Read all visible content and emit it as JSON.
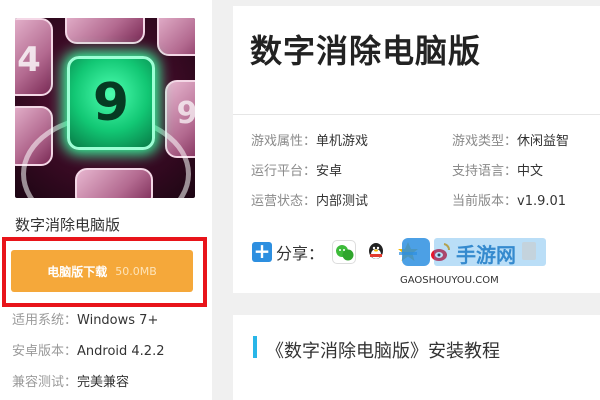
{
  "app": {
    "name": "数字消除电脑版",
    "icon_tile_number": "9",
    "icon_side_numbers": [
      "4",
      "9"
    ]
  },
  "download": {
    "label": "电脑版下载",
    "size": "50.0MB",
    "highlight_color": "#e8141a",
    "button_color": "#f5a83a"
  },
  "sidebar_info": [
    {
      "key": "适用系统：",
      "value": "Windows 7+"
    },
    {
      "key": "安卓版本：",
      "value": "Android 4.2.2"
    },
    {
      "key": "兼容测试：",
      "value": "完美兼容"
    }
  ],
  "header": {
    "title": "数字消除电脑版"
  },
  "attributes": [
    {
      "key": "游戏属性：",
      "value": "单机游戏"
    },
    {
      "key": "游戏类型：",
      "value": "休闲益智"
    },
    {
      "key": "运行平台：",
      "value": "安卓"
    },
    {
      "key": "支持语言：",
      "value": "中文"
    },
    {
      "key": "运营状态：",
      "value": "内部测试"
    },
    {
      "key": "当前版本：",
      "value": "v1.9.01"
    }
  ],
  "share": {
    "label": "分享：",
    "icons": [
      "wechat-icon",
      "qq-icon",
      "qzone-icon",
      "weibo-icon",
      "copy-icon"
    ]
  },
  "watermark": {
    "brand": "手游网",
    "url": "GAOSHOUYOU.COM"
  },
  "section": {
    "accent_color": "#29b6e8",
    "heading": "《数字消除电脑版》安装教程"
  }
}
